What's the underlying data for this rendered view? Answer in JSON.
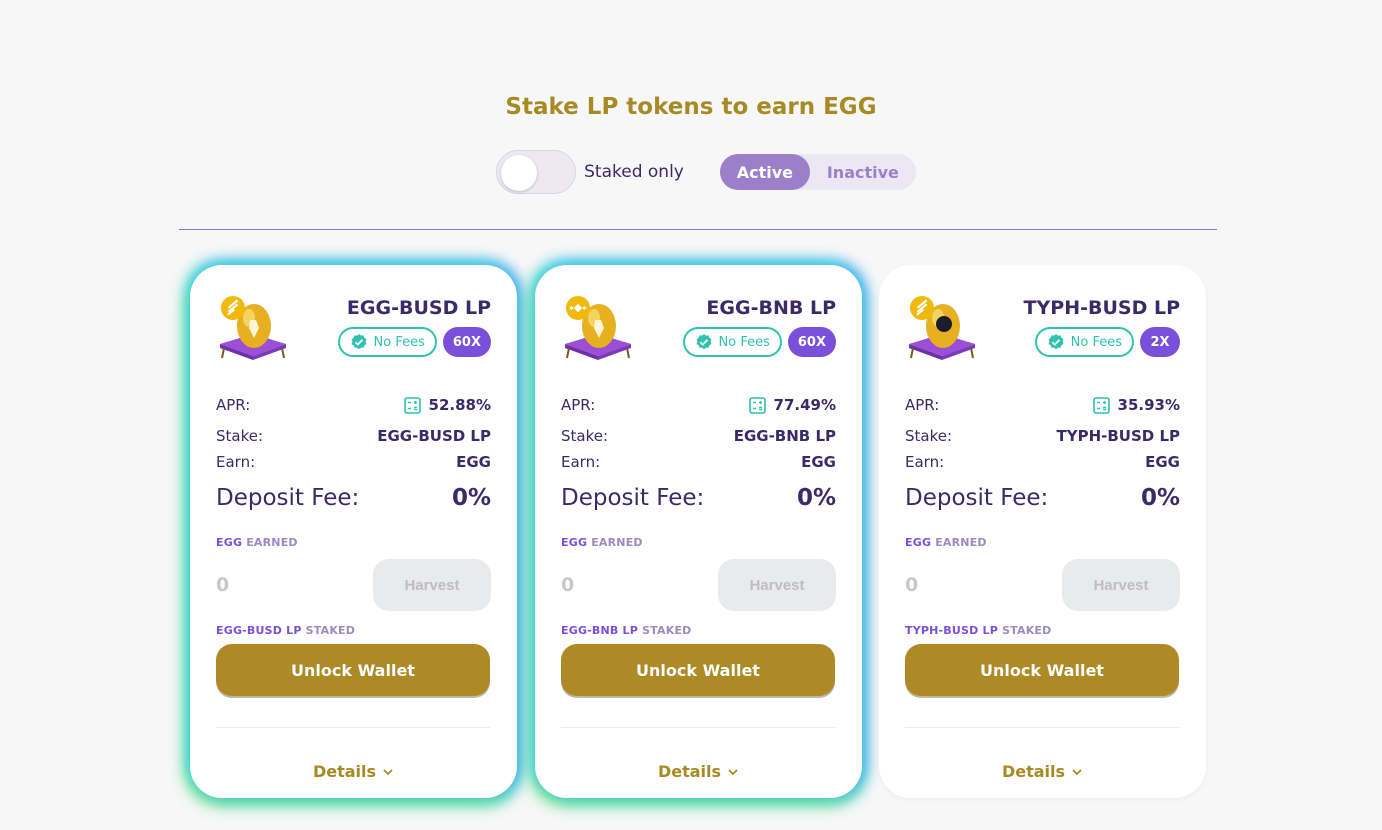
{
  "page": {
    "title": "Stake LP tokens to earn EGG",
    "staked_only_label": "Staked only",
    "tabs": [
      {
        "label": "Active",
        "selected": true
      },
      {
        "label": "Inactive",
        "selected": false
      }
    ]
  },
  "colors": {
    "accent_gold": "#ad8a26",
    "title_gold": "#a88a24",
    "purple_text": "#3b2a68",
    "multiplier_bg": "#7a4fd9",
    "no_fees_teal": "#2fc2b0",
    "tab_active_bg": "#9b80c9"
  },
  "cards": [
    {
      "name": "EGG-BUSD LP",
      "token_icon": "busd-coin-icon",
      "no_fees_label": "No Fees",
      "multiplier": "60X",
      "apr_label": "APR:",
      "apr_value": "52.88%",
      "stake_label": "Stake:",
      "stake_value": "EGG-BUSD LP",
      "earn_label": "Earn:",
      "earn_value": "EGG",
      "fee_label": "Deposit Fee:",
      "fee_value": "0%",
      "earned_token": "EGG",
      "earned_suffix": "EARNED",
      "earned_value": "0",
      "harvest_label": "Harvest",
      "staked_token": "EGG-BUSD LP",
      "staked_suffix": "STAKED",
      "unlock_label": "Unlock Wallet",
      "details_label": "Details"
    },
    {
      "name": "EGG-BNB LP",
      "token_icon": "bnb-coin-icon",
      "no_fees_label": "No Fees",
      "multiplier": "60X",
      "apr_label": "APR:",
      "apr_value": "77.49%",
      "stake_label": "Stake:",
      "stake_value": "EGG-BNB LP",
      "earn_label": "Earn:",
      "earn_value": "EGG",
      "fee_label": "Deposit Fee:",
      "fee_value": "0%",
      "earned_token": "EGG",
      "earned_suffix": "EARNED",
      "earned_value": "0",
      "harvest_label": "Harvest",
      "staked_token": "EGG-BNB LP",
      "staked_suffix": "STAKED",
      "unlock_label": "Unlock Wallet",
      "details_label": "Details"
    },
    {
      "name": "TYPH-BUSD LP",
      "token_icon": "busd-coin-icon",
      "no_fees_label": "No Fees",
      "multiplier": "2X",
      "apr_label": "APR:",
      "apr_value": "35.93%",
      "stake_label": "Stake:",
      "stake_value": "TYPH-BUSD LP",
      "earn_label": "Earn:",
      "earn_value": "EGG",
      "fee_label": "Deposit Fee:",
      "fee_value": "0%",
      "earned_token": "EGG",
      "earned_suffix": "EARNED",
      "earned_value": "0",
      "harvest_label": "Harvest",
      "staked_token": "TYPH-BUSD LP",
      "staked_suffix": "STAKED",
      "unlock_label": "Unlock Wallet",
      "details_label": "Details"
    }
  ]
}
